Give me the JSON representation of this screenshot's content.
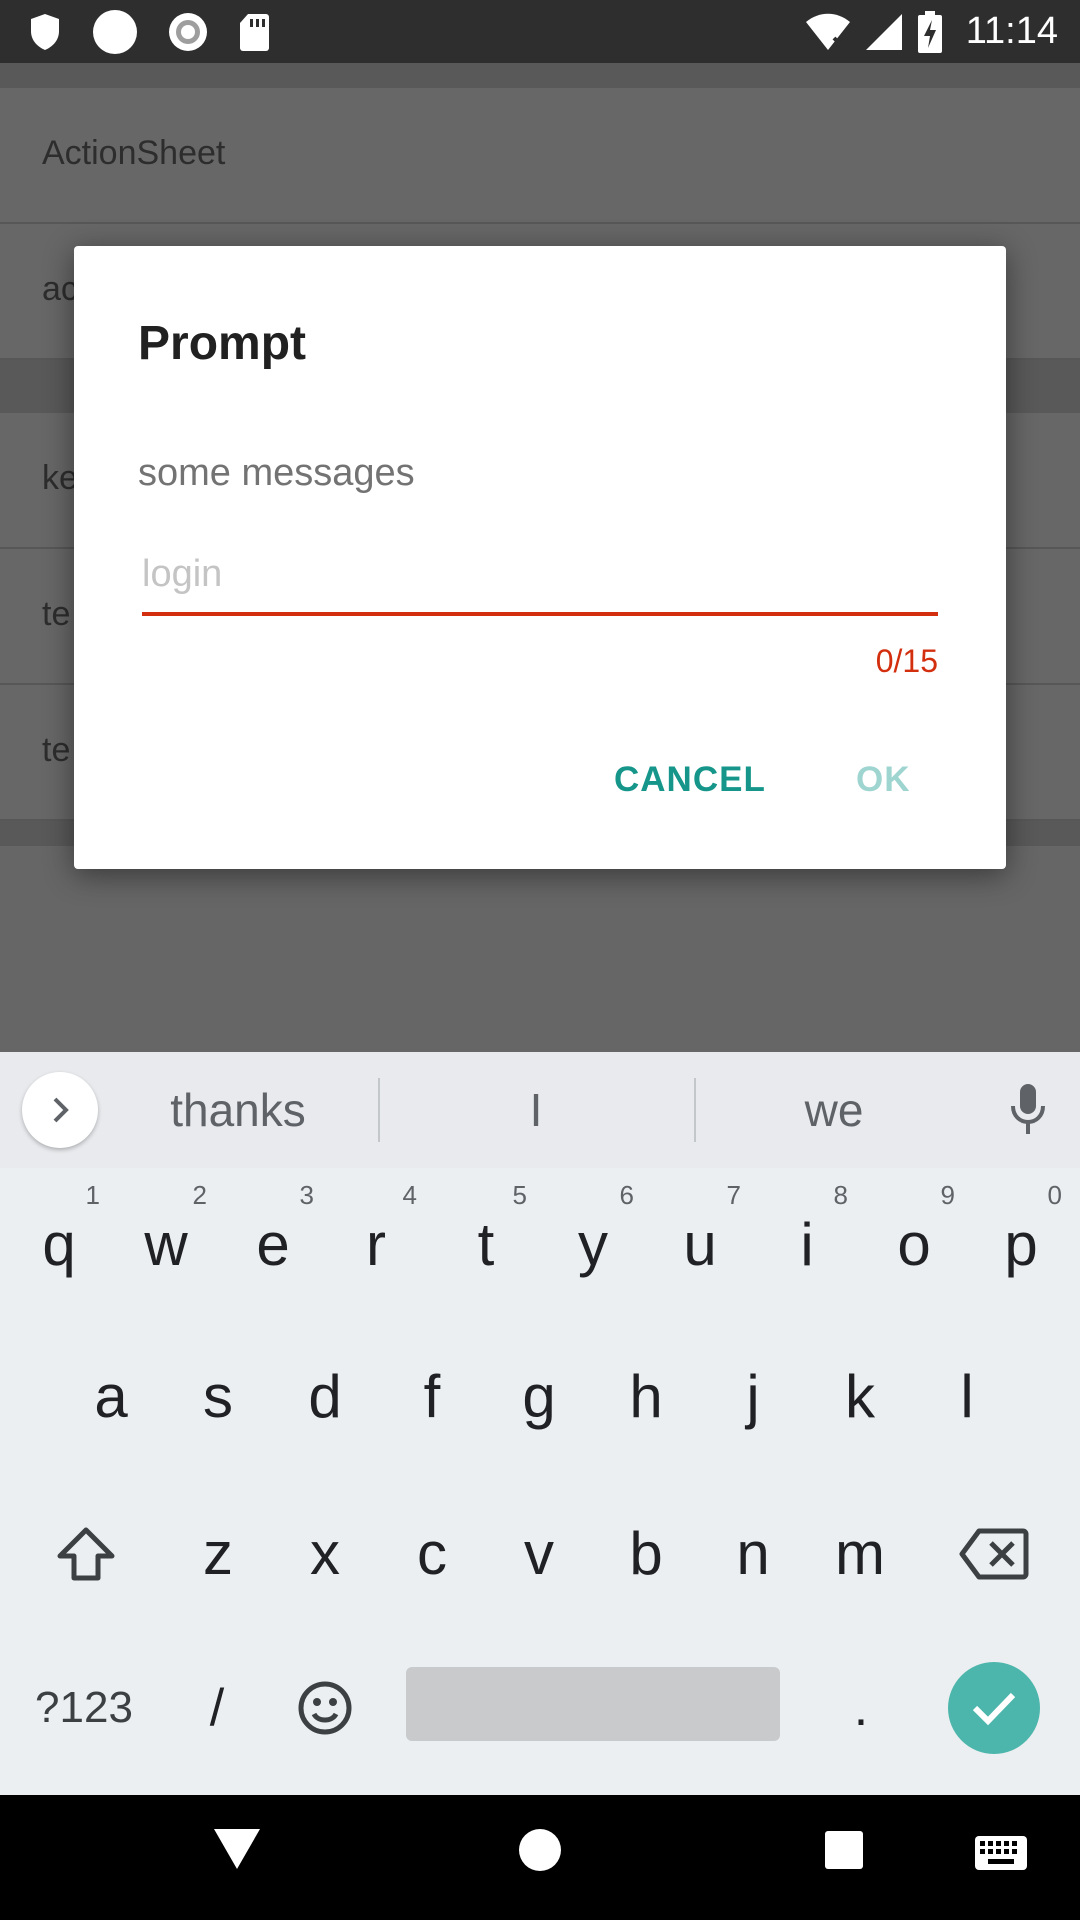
{
  "status_bar": {
    "time": "11:14",
    "left_icons": [
      "shield-icon",
      "circle-icon",
      "record-icon",
      "sd-card-icon"
    ],
    "right_icons": [
      "wifi-icon",
      "signal-icon",
      "battery-icon"
    ]
  },
  "background_list": {
    "rows": [
      "ActionSheet",
      "ac",
      "ke",
      "te",
      "te"
    ]
  },
  "dialog": {
    "title": "Prompt",
    "message": "some messages",
    "input_placeholder": "login",
    "input_value": "",
    "counter": "0/15",
    "cancel_label": "CANCEL",
    "ok_label": "OK",
    "accent_color": "#16968a",
    "error_color": "#d32f0f"
  },
  "keyboard": {
    "suggestions": [
      "thanks",
      "I",
      "we"
    ],
    "row1": [
      {
        "k": "q",
        "h": "1"
      },
      {
        "k": "w",
        "h": "2"
      },
      {
        "k": "e",
        "h": "3"
      },
      {
        "k": "r",
        "h": "4"
      },
      {
        "k": "t",
        "h": "5"
      },
      {
        "k": "y",
        "h": "6"
      },
      {
        "k": "u",
        "h": "7"
      },
      {
        "k": "i",
        "h": "8"
      },
      {
        "k": "o",
        "h": "9"
      },
      {
        "k": "p",
        "h": "0"
      }
    ],
    "row2": [
      "a",
      "s",
      "d",
      "f",
      "g",
      "h",
      "j",
      "k",
      "l"
    ],
    "row3": [
      "z",
      "x",
      "c",
      "v",
      "b",
      "n",
      "m"
    ],
    "symbols_label": "?123",
    "slash_label": "/",
    "period_label": ".",
    "enter_color": "#4db6ac"
  },
  "nav_bar": {
    "icons": [
      "back-icon",
      "home-icon",
      "recents-icon",
      "keyboard-switch-icon"
    ]
  }
}
